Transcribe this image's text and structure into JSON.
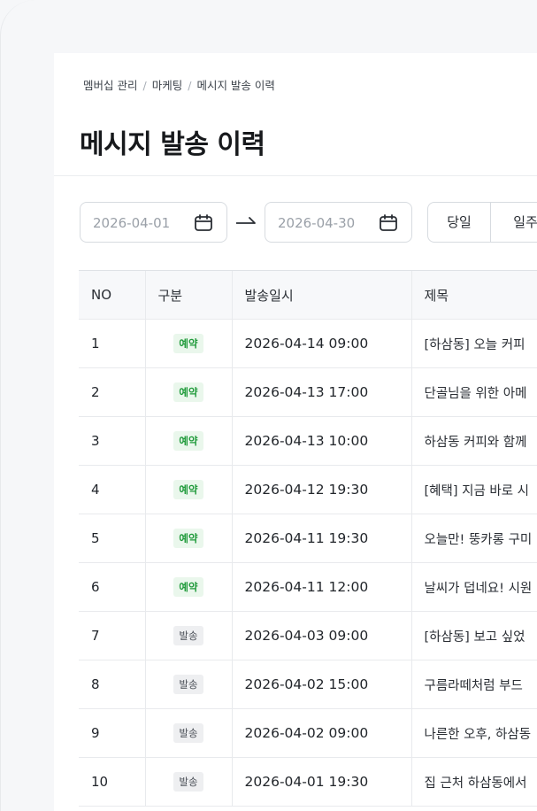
{
  "breadcrumb": {
    "items": [
      "멤버십 관리",
      "마케팅",
      "메시지 발송 이력"
    ],
    "separator": "/"
  },
  "page_title": "메시지 발송 이력",
  "filters": {
    "start_date": "2026-04-01",
    "end_date": "2026-04-30",
    "range_buttons": [
      "당일",
      "일주"
    ]
  },
  "table": {
    "headers": [
      "NO",
      "구분",
      "발송일시",
      "제목"
    ],
    "rows": [
      {
        "no": "1",
        "type": "예약",
        "datetime": "2026-04-14 09:00",
        "title": "[하삼동] 오늘 커피"
      },
      {
        "no": "2",
        "type": "예약",
        "datetime": "2026-04-13 17:00",
        "title": "단골님을 위한 아메"
      },
      {
        "no": "3",
        "type": "예약",
        "datetime": "2026-04-13 10:00",
        "title": "하삼동 커피와 함께"
      },
      {
        "no": "4",
        "type": "예약",
        "datetime": "2026-04-12 19:30",
        "title": "[혜택] 지금 바로 시"
      },
      {
        "no": "5",
        "type": "예약",
        "datetime": "2026-04-11 19:30",
        "title": "오늘만! 뚱카롱 구미"
      },
      {
        "no": "6",
        "type": "예약",
        "datetime": "2026-04-11 12:00",
        "title": "날씨가 덥네요! 시원"
      },
      {
        "no": "7",
        "type": "발송",
        "datetime": "2026-04-03 09:00",
        "title": "[하삼동] 보고 싶었"
      },
      {
        "no": "8",
        "type": "발송",
        "datetime": "2026-04-02 15:00",
        "title": "구름라떼처럼 부드"
      },
      {
        "no": "9",
        "type": "발송",
        "datetime": "2026-04-02 09:00",
        "title": "나른한 오후, 하삼동"
      },
      {
        "no": "10",
        "type": "발송",
        "datetime": "2026-04-01 19:30",
        "title": "집 근처 하삼동에서"
      }
    ]
  },
  "colors": {
    "reserved_badge_text": "#1f9a3a",
    "reserved_badge_bg": "#eaf7ec",
    "sent_badge_bg": "#eeeff1"
  },
  "icons": {
    "date_picker": "calendar-icon",
    "range_arrow": "arrow-right-icon"
  }
}
